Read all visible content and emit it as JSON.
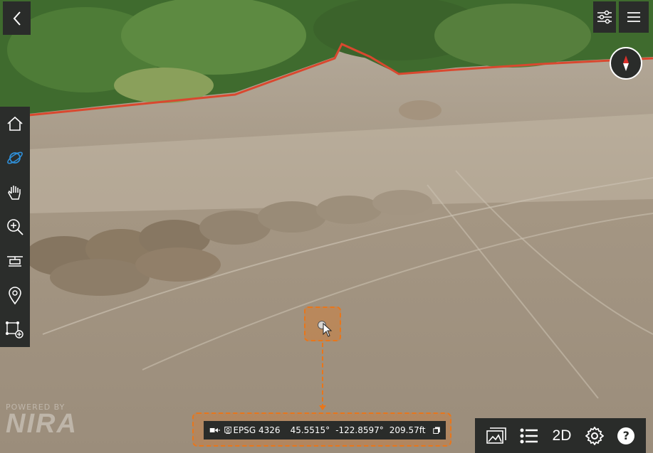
{
  "viewer": {
    "brand_small": "POWERED BY",
    "brand_large": "NIRA"
  },
  "coords": {
    "crs": "EPSG 4326",
    "latitude": "45.5515°",
    "longitude": "-122.8597°",
    "elevation": "209.57ft"
  },
  "bottom_toolbar": {
    "view_mode_label": "2D",
    "help_label": "?"
  },
  "icons": {
    "back": "chevron-left-icon",
    "filters": "sliders-icon",
    "menu": "hamburger-menu-icon",
    "compass": "compass-icon",
    "sidebar": [
      "home-icon",
      "orbit-icon",
      "hand-pan-icon",
      "zoom-in-icon",
      "drone-icon",
      "map-pin-icon",
      "add-annotation-icon"
    ]
  },
  "colors": {
    "accent": "#e8761b",
    "panel": "#2a2c2a",
    "orbit_active": "#2f8fd8"
  }
}
